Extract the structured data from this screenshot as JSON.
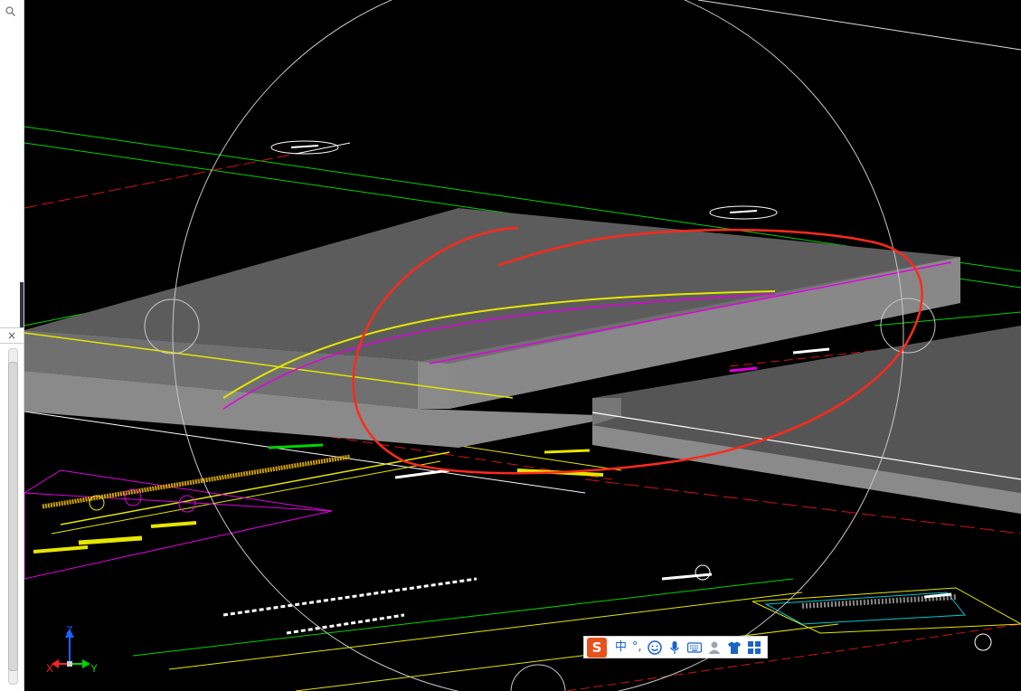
{
  "window": {
    "title": ""
  },
  "left_panel": {
    "search_icon": "search-icon",
    "close_glyph": "×"
  },
  "viewport": {
    "background": "#000000",
    "ucs_icon": {
      "x_label": "X",
      "y_label": "Y",
      "z_label": "Z"
    },
    "orbit_circle_color": "#c8c8c8",
    "annotation_color": "#ff2a1a",
    "slab_color": "#7a7a7a",
    "line_colors": {
      "green": "#00d400",
      "yellow": "#e6e600",
      "magenta": "#e100e1",
      "red": "#d21414",
      "white": "#ffffff",
      "cyan": "#00c8d2"
    }
  },
  "ime_toolbar": {
    "logo_letter": "S",
    "mode_label": "中",
    "punct_label": "°,",
    "icons": [
      "emoji-icon",
      "microphone-icon",
      "keyboard-icon",
      "user-icon",
      "tshirt-icon",
      "grid-icon"
    ]
  }
}
